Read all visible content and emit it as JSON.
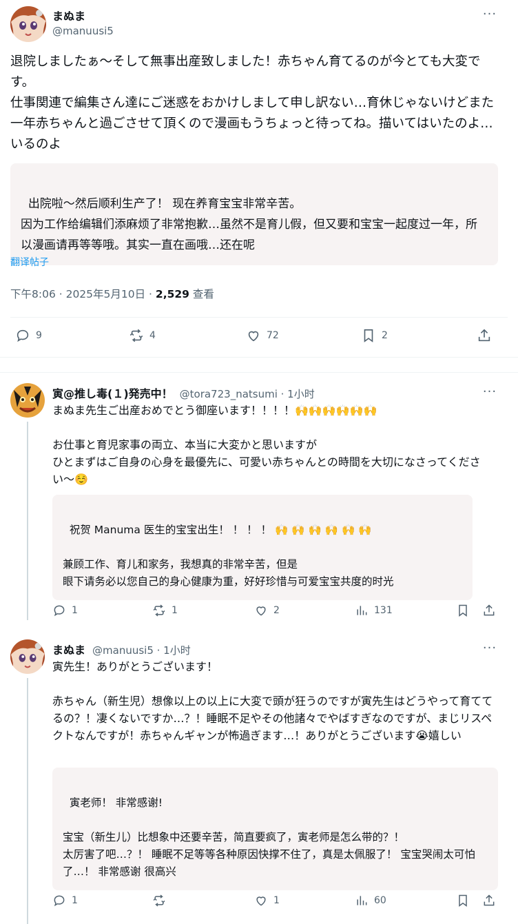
{
  "main_post": {
    "author_name": "まぬま",
    "author_handle": "@manuusi5",
    "avatar": "anime-girl-avatar",
    "text": "退院しましたぁ〜そして無事出産致しました！赤ちゃん育てるのが今とても大変です。\n仕事関連で編集さん達にご迷惑をおかけしまして申し訳ない…育休じゃないけどまた一年赤ちゃんと過ごさせて頂くので漫画もうちょっと待ってね。描いてはいたのよ…いるのよ",
    "translation": "出院啦〜然后顺利生产了！ 现在养育宝宝非常辛苦。\n因为工作给编辑们添麻烦了非常抱歉…虽然不是育儿假，但又要和宝宝一起度过一年，所以漫画请再等等哦。其实一直在画哦…还在呢",
    "translate_link": "翻译帖子",
    "timestamp": "下午8:06 · 2025年5月10日 · ",
    "views_count": "2,529",
    "views_label": " 查看",
    "replies": "9",
    "reposts": "4",
    "likes": "72",
    "bookmarks": "2"
  },
  "replies": [
    {
      "author_name": "寅@推し毒(１)発売中！",
      "author_handle": "@tora723_natsumi · 1小时",
      "avatar": "tiger-avatar",
      "text": "まぬま先生ご出産おめでとう御座います！！！！🙌🙌🙌🙌🙌🙌\n\nお仕事と育児家事の両立、本当に大変かと思いますが\nひとまずはご自身の心身を最優先に、可愛い赤ちゃんとの時間を大切になさってください〜☺️",
      "translation": "祝贺 Manuma 医生的宝宝出生！ ！ ！ ！ 🙌 🙌 🙌 🙌 🙌 🙌\n\n兼顾工作、育儿和家务，我想真的非常辛苦，但是\n眼下请务必以您自己的身心健康为重，好好珍惜与可爱宝宝共度的时光",
      "replies": "1",
      "reposts": "1",
      "likes": "2",
      "views": "131"
    },
    {
      "author_name": "まぬま",
      "author_handle": "@manuusi5 · 1小时",
      "avatar": "anime-girl-avatar",
      "text": "寅先生！ありがとうございます！\n\n赤ちゃん（新生児）想像以上の以上に大変で頭が狂うのですが寅先生はどうやって育ててるの？！凄くないですか…？！睡眠不足やその他諸々でやばすぎなのですが、まじリスペクトなんですが！赤ちゃんギャンが怖過ぎます…！ありがとうございます😭嬉しい",
      "translation": "寅老师！ 非常感谢!\n\n宝宝（新生儿）比想象中还要辛苦，简直要疯了，寅老师是怎么带的？！\n太厉害了吧…？！ 睡眠不足等等各种原因快撑不住了，真是太佩服了！ 宝宝哭闹太可怕了…！ 非常感谢 很高兴",
      "replies": "1",
      "reposts": "",
      "likes": "1",
      "views": "60"
    }
  ],
  "icons": {
    "reply": "reply-icon",
    "repost": "repost-icon",
    "like": "heart-icon",
    "bookmark": "bookmark-icon",
    "share": "share-icon",
    "views": "analytics-icon",
    "more": "more-icon"
  },
  "colors": {
    "text": "#0f1419",
    "secondary": "#536471",
    "translation_bg": "#f7f3f3",
    "link": "#1d9bf0"
  }
}
